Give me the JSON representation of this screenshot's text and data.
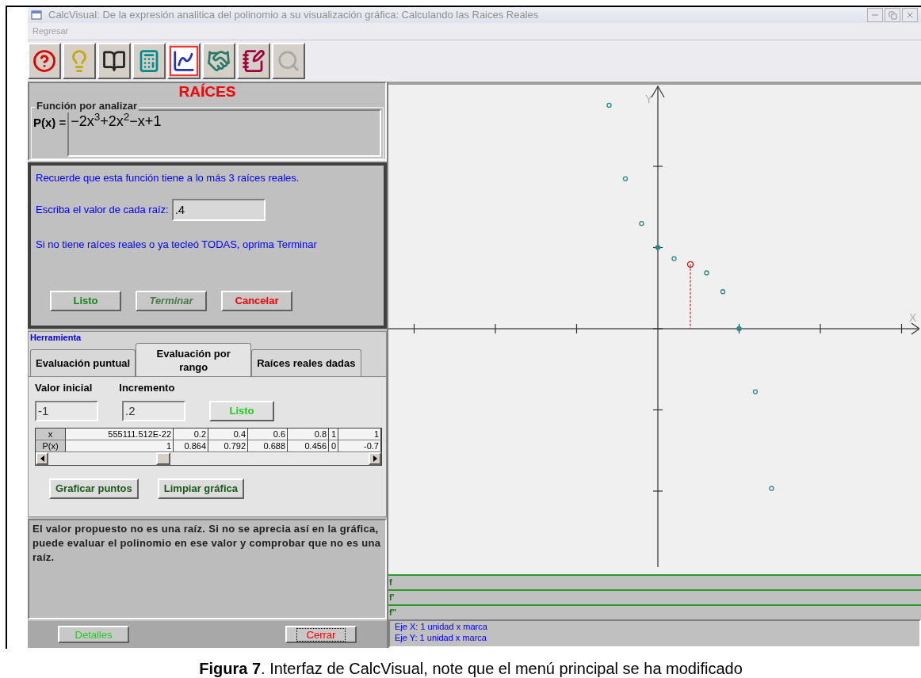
{
  "window": {
    "title": "CalcVisual: De la expresión analitica del polinomio a su visualización gráfica: Calculando las Raices Reales"
  },
  "menu": [
    "Regresar"
  ],
  "toolbar": [
    {
      "kind": "help",
      "selected": false,
      "disabled": false
    },
    {
      "kind": "idea",
      "selected": false,
      "disabled": false
    },
    {
      "kind": "book",
      "selected": false,
      "disabled": false
    },
    {
      "kind": "calculator",
      "selected": false,
      "disabled": false
    },
    {
      "kind": "graph",
      "selected": true,
      "disabled": false
    },
    {
      "kind": "handshake",
      "selected": false,
      "disabled": false
    },
    {
      "kind": "notebook",
      "selected": false,
      "disabled": false
    },
    {
      "kind": "search",
      "selected": false,
      "disabled": true
    }
  ],
  "section_title": "RAÍCES",
  "function_group": {
    "legend": "Función por analizar",
    "label": "P(x) =",
    "expression": "−2x$^{3}$+2x$^{2}$−x+1"
  },
  "dialog": {
    "info": "Recuerde que esta función tiene a lo más 3 raíces reales.",
    "root_label": "Escriba el valor de cada raíz:",
    "root_value": ".4",
    "note": "Si no tiene raíces reales o ya tecleó TODAS, oprima Terminar",
    "buttons": [
      {
        "label": "Listo",
        "disabled": false,
        "color": "#118811"
      },
      {
        "label": "Terminar",
        "disabled": true,
        "color": "#4a7a4a"
      },
      {
        "label": "Cancelar",
        "disabled": false,
        "color": "#ff0000"
      }
    ]
  },
  "tools": {
    "legend": "Herramienta",
    "tabs": [
      {
        "label": "Evaluación puntual",
        "selected": false
      },
      {
        "label": "Evaluación por rango",
        "selected": true
      },
      {
        "label": "Raíces reales dadas",
        "selected": false
      }
    ],
    "initial_label": "Valor inicial",
    "initial_value": "-1",
    "increment_label": "Incremento",
    "increment_value": ".2",
    "ok_button": "Listo",
    "table": {
      "rows": [
        [
          "x",
          "555111.512E-22",
          "0.2",
          "0.4",
          "0.6",
          "0.8",
          "1",
          "1"
        ],
        [
          "P(x)",
          "1",
          "0.864",
          "0.792",
          "0.688",
          "0.456",
          "0",
          "-0.7"
        ]
      ]
    },
    "buttons": [
      "Graficar puntos",
      "Limpiar gráfica"
    ]
  },
  "message": {
    "text": "El valor propuesto no es una raíz. Si no se aprecia así en la gráfica, puede evaluar el polinomio en ese valor y comprobar que no es una raíz.",
    "buttons": [
      {
        "label": "Detalles",
        "color": "#22cc22",
        "focused": false
      },
      {
        "label": "Cerrar",
        "color": "#ff0000",
        "focused": true
      }
    ]
  },
  "graph": {
    "y_label": "Y",
    "x_label": "X"
  },
  "functions": [
    "f",
    "f'",
    "f''"
  ],
  "axis_info": [
    "Eje X: 1 unidad x marca",
    "Eje Y: 1 unidad x marca"
  ],
  "caption": "**Figura 7**. Interfaz de CalcVisual, note que el menú principal se ha modificado"
}
